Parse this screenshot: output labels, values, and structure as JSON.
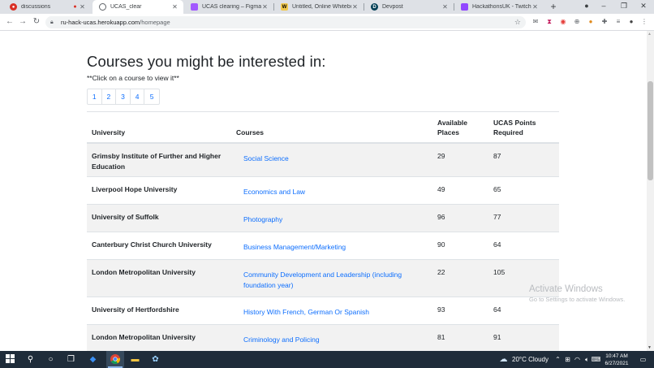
{
  "browser": {
    "tabs": [
      {
        "title": "discussions",
        "icon": "discord-icon",
        "color": "#d93025"
      },
      {
        "title": "UCAS_clear",
        "icon": "globe-icon",
        "color": "#5f6368"
      },
      {
        "title": "UCAS clearing – Figma",
        "icon": "figma-icon",
        "color": "#a259ff"
      },
      {
        "title": "Untitled, Online Whiteboard",
        "icon": "miro-icon",
        "color": "#f2c94c"
      },
      {
        "title": "Devpost",
        "icon": "devpost-icon",
        "color": "#003e54"
      },
      {
        "title": "HackathonsUK - Twitch",
        "icon": "twitch-icon",
        "color": "#9146ff"
      }
    ],
    "url_host": "ru-hack-ucas.herokuapp.com",
    "url_path": "/homepage"
  },
  "page": {
    "heading": "Courses you might be interested in:",
    "hint": "**Click on a course to view it**",
    "pages": [
      "1",
      "2",
      "3",
      "4",
      "5"
    ],
    "table": {
      "headers": {
        "university": "University",
        "courses": "Courses",
        "places_line1": "Available",
        "places_line2": "Places",
        "points_line1": "UCAS Points",
        "points_line2": "Required"
      },
      "rows": [
        {
          "university": "Grimsby Institute of Further and Higher Education",
          "course": "Social Science",
          "places": "29",
          "points": "87"
        },
        {
          "university": "Liverpool Hope University",
          "course": "Economics and Law",
          "places": "49",
          "points": "65"
        },
        {
          "university": "University of Suffolk",
          "course": "Photography",
          "places": "96",
          "points": "77"
        },
        {
          "university": "Canterbury Christ Church University",
          "course": "Business Management/Marketing",
          "places": "90",
          "points": "64"
        },
        {
          "university": "London Metropolitan University",
          "course": "Community Development and Leadership (including foundation year)",
          "places": "22",
          "points": "105"
        },
        {
          "university": "University of Hertfordshire",
          "course": "History With French, German Or Spanish",
          "places": "93",
          "points": "64"
        },
        {
          "university": "London Metropolitan University",
          "course": "Criminology and Policing",
          "places": "81",
          "points": "91"
        }
      ]
    }
  },
  "watermark": {
    "title": "Activate Windows",
    "subtitle": "Go to Settings to activate Windows."
  },
  "taskbar": {
    "weather": "20°C  Cloudy",
    "time": "10:47 AM",
    "date": "6/27/2021"
  }
}
